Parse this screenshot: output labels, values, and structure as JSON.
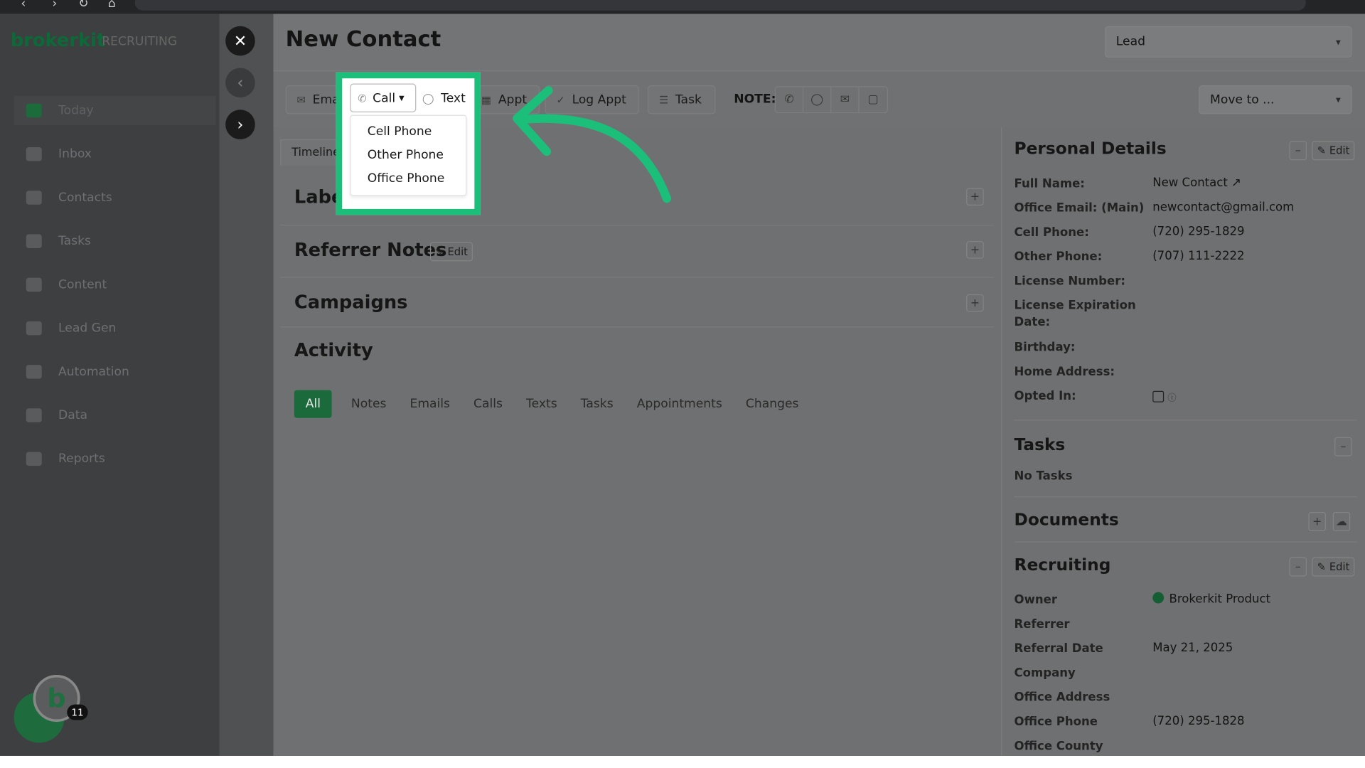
{
  "background": {
    "logo": "brokerkit",
    "logo_sub": "RECRUITING",
    "sidebar": [
      "Today",
      "Inbox",
      "Contacts",
      "Tasks",
      "Content",
      "Lead Gen",
      "Automation",
      "Data",
      "Reports"
    ],
    "chat_badge": "11",
    "chat_logo": "b"
  },
  "modal": {
    "title": "New Contact",
    "stage_select": "Lead",
    "move_to": "Move to ...",
    "toolbar": {
      "email": "Ema",
      "call": "Call",
      "text": "Text",
      "appt": "Appt",
      "log_appt": "Log Appt",
      "task": "Task",
      "note_label": "NOTE:"
    },
    "call_menu": [
      "Cell Phone",
      "Other Phone",
      "Office Phone"
    ],
    "timeline_tab": "Timeline",
    "labels_title": "Labels",
    "referrer_notes_title": "Referrer Notes",
    "edit": "Edit",
    "campaigns_title": "Campaigns",
    "activity_title": "Activity",
    "activity_tabs": [
      "All",
      "Notes",
      "Emails",
      "Calls",
      "Texts",
      "Tasks",
      "Appointments",
      "Changes"
    ]
  },
  "personal_details": {
    "title": "Personal Details",
    "rows": [
      {
        "k": "Full Name:",
        "v": "New Contact"
      },
      {
        "k": "Office Email: (Main)",
        "v": "newcontact@gmail.com"
      },
      {
        "k": "Cell Phone:",
        "v": "(720) 295-1829"
      },
      {
        "k": "Other Phone:",
        "v": "(707) 111-2222"
      },
      {
        "k": "License Number:",
        "v": ""
      },
      {
        "k": "License Expiration Date:",
        "v": ""
      },
      {
        "k": "Birthday:",
        "v": ""
      },
      {
        "k": "Home Address:",
        "v": ""
      },
      {
        "k": "Opted In:",
        "v": ""
      }
    ]
  },
  "tasks": {
    "title": "Tasks",
    "empty": "No Tasks"
  },
  "documents": {
    "title": "Documents"
  },
  "recruiting": {
    "title": "Recruiting",
    "rows": [
      {
        "k": "Owner",
        "v": "Brokerkit Product"
      },
      {
        "k": "Referrer",
        "v": ""
      },
      {
        "k": "Referral Date",
        "v": "May 21, 2025"
      },
      {
        "k": "Company",
        "v": ""
      },
      {
        "k": "Office Address",
        "v": ""
      },
      {
        "k": "Office Phone",
        "v": "(720) 295-1828"
      },
      {
        "k": "Office County",
        "v": ""
      }
    ]
  },
  "colors": {
    "highlight": "#1cbf7a",
    "brand": "#1a6a3b"
  }
}
